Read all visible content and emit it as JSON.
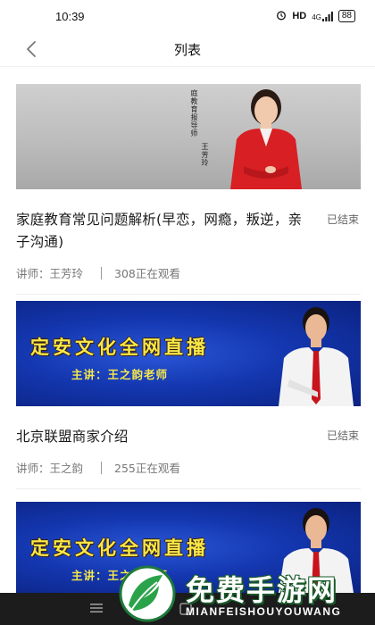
{
  "status_bar": {
    "time": "10:39",
    "hd": "HD",
    "signal": "4G",
    "battery": "88"
  },
  "header": {
    "title": "列表"
  },
  "items": [
    {
      "title": "家庭教育常见问题解析(早恋，网瘾，叛逆，亲子沟通)",
      "status": "已结束",
      "lecturer": "讲师：王芳玲",
      "viewers": "308正在观看",
      "thumbnail": {
        "vertical_text": "庭教育报导师",
        "vertical_name": "王芳玲"
      }
    },
    {
      "title": "北京联盟商家介绍",
      "status": "已结束",
      "lecturer": "讲师：王之韵",
      "viewers": "255正在观看",
      "thumbnail": {
        "banner_main": "定安文化全网直播",
        "banner_sub": "主讲：王之韵老师"
      }
    },
    {
      "thumbnail": {
        "banner_main": "定安文化全网直播",
        "banner_sub": "主讲：王之韵老师"
      }
    }
  ],
  "watermark": {
    "text": "免费手游网",
    "sub": "MIANFEISHOUYOUWANG"
  },
  "colors": {
    "banner_text": "#f7e84a",
    "banner_blue": "#1437b0",
    "status_grey": "#666666"
  }
}
